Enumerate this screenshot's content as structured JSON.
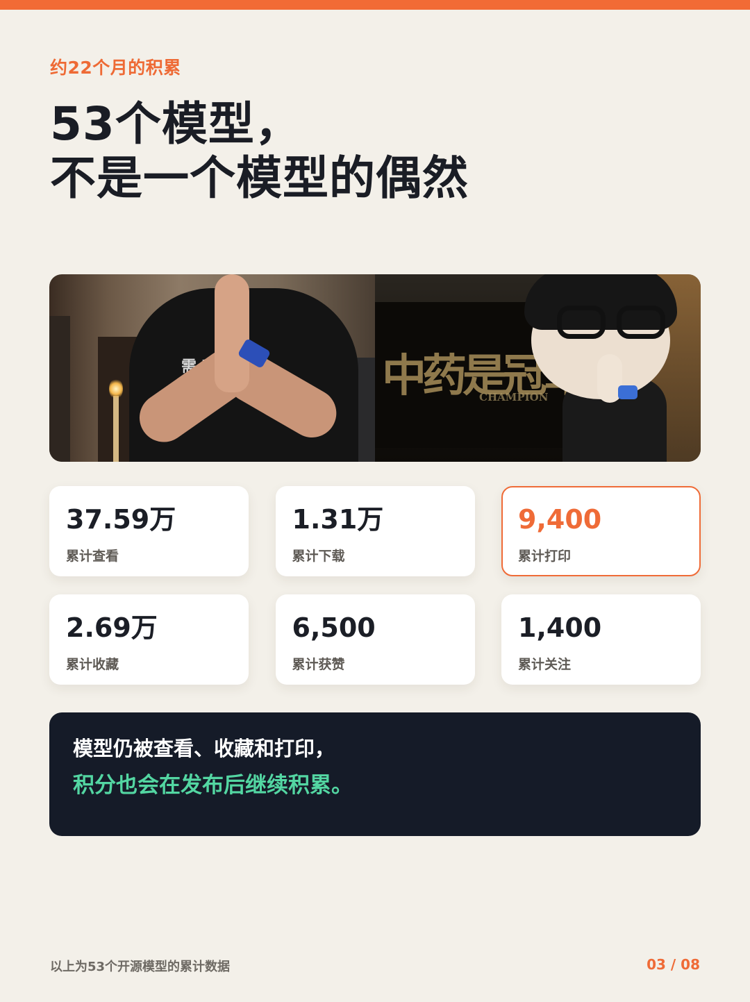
{
  "header": {
    "eyebrow": "约22个月的积累",
    "headline_line1": "53个模型，",
    "headline_line2": "不是一个模型的偶然"
  },
  "colors": {
    "accent": "#ef6b37",
    "background": "#f3f0e9",
    "callout_bg": "#151b28",
    "callout_highlight": "#53d6a2"
  },
  "stats": [
    {
      "value": "37.59万",
      "label": "累计查看"
    },
    {
      "value": "1.31万",
      "label": "累计下载"
    },
    {
      "value": "9,400",
      "label": "累计打印"
    },
    {
      "value": "2.69万",
      "label": "累计收藏"
    },
    {
      "value": "6,500",
      "label": "累计获赞"
    },
    {
      "value": "1,400",
      "label": "累计关注"
    }
  ],
  "callout": {
    "line1": "模型仍被查看、收藏和打印，",
    "line2": "积分也会在发布后继续积累。"
  },
  "footer": {
    "note": "以上为53个开源模型的累计数据",
    "page": "03 / 08"
  }
}
